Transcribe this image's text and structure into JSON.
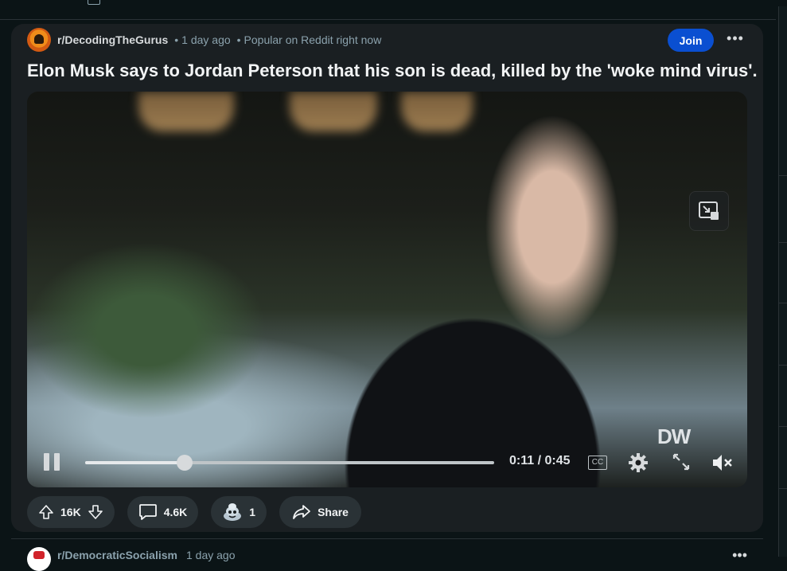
{
  "post": {
    "subreddit": "r/DecodingTheGurus",
    "time_ago": "1 day ago",
    "popular_note": "Popular on Reddit right now",
    "join_label": "Join",
    "more_label": "•••",
    "title": "Elon Musk says to Jordan Peterson that his son is dead, killed by the 'woke mind virus'.",
    "video": {
      "watermark": "DW",
      "time_display": "0:11 / 0:45",
      "progress_fraction": 0.244,
      "cc_label": "CC"
    },
    "actions": {
      "upvotes": "16K",
      "comments": "4.6K",
      "awards": "1",
      "share_label": "Share"
    }
  },
  "next_post": {
    "subreddit": "r/DemocraticSocialism",
    "time_ago": "1 day ago",
    "more_label": "•••"
  },
  "colors": {
    "background": "#0b1416",
    "card": "#1a1f22",
    "join_button": "#0a4fd1",
    "pill": "#2a3236",
    "meta_text": "#8ba2ad"
  }
}
